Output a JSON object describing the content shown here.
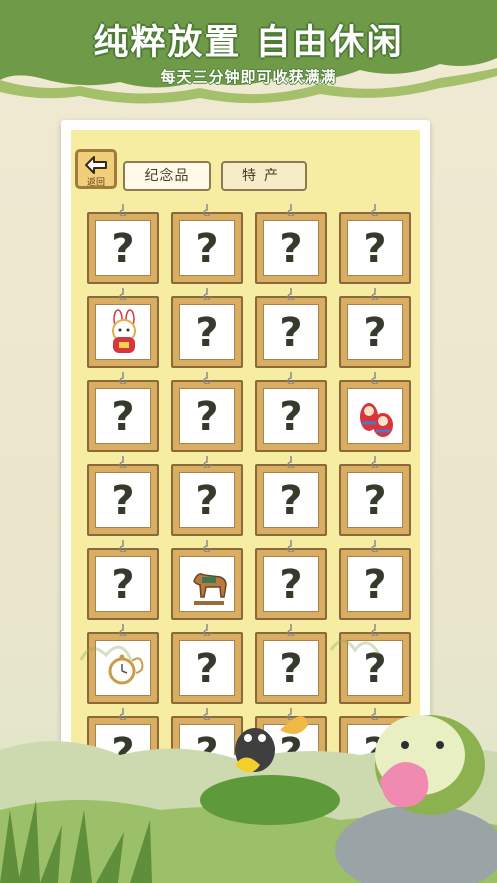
{
  "promo": {
    "title": "纯粹放置 自由休闲",
    "subtitle": "每天三分钟即可收获满满"
  },
  "header": {
    "back_label": "返回",
    "tabs": [
      {
        "label": "纪念品"
      },
      {
        "label": "特产"
      }
    ]
  },
  "grid": {
    "unknown_mark": "?",
    "items": [
      {
        "state": "unknown"
      },
      {
        "state": "unknown"
      },
      {
        "state": "unknown"
      },
      {
        "state": "unknown"
      },
      {
        "state": "found",
        "icon": "rabbit-doll-icon"
      },
      {
        "state": "unknown"
      },
      {
        "state": "unknown"
      },
      {
        "state": "unknown"
      },
      {
        "state": "unknown"
      },
      {
        "state": "unknown"
      },
      {
        "state": "unknown"
      },
      {
        "state": "found",
        "icon": "matryoshka-icon"
      },
      {
        "state": "unknown"
      },
      {
        "state": "unknown"
      },
      {
        "state": "unknown"
      },
      {
        "state": "unknown"
      },
      {
        "state": "unknown"
      },
      {
        "state": "found",
        "icon": "tang-horse-icon"
      },
      {
        "state": "unknown"
      },
      {
        "state": "unknown"
      },
      {
        "state": "found",
        "icon": "pocket-watch-icon"
      },
      {
        "state": "unknown"
      },
      {
        "state": "unknown"
      },
      {
        "state": "unknown"
      },
      {
        "state": "unknown"
      },
      {
        "state": "unknown"
      },
      {
        "state": "unknown"
      },
      {
        "state": "unknown"
      }
    ]
  },
  "colors": {
    "panel_bg": "#f6eda2",
    "frame": "#d9ad62",
    "title_outline": "#4d7a35"
  }
}
